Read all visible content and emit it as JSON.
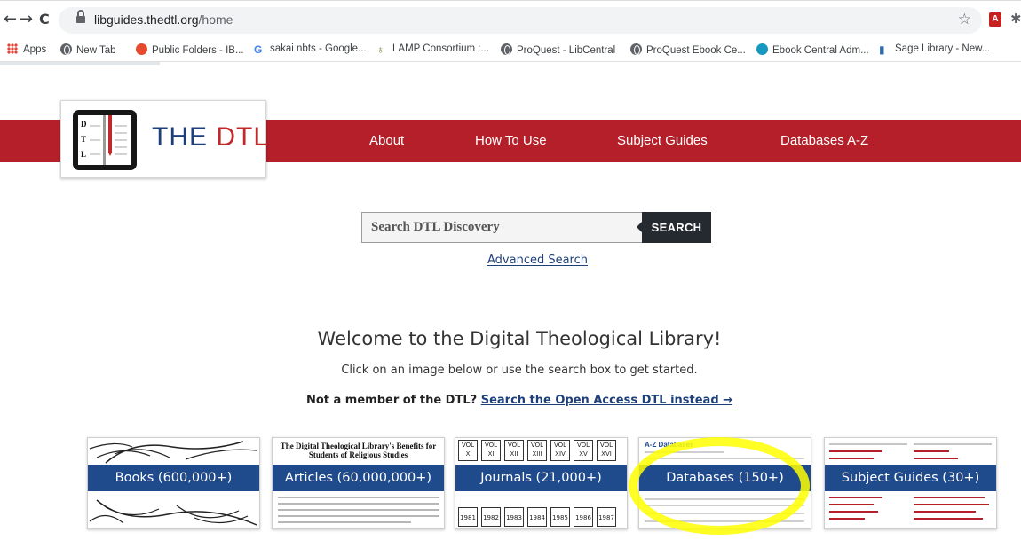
{
  "browser": {
    "url_host": "libguides.thedtl.org",
    "url_path": "/home",
    "back_glyph": "←",
    "forward_glyph": "→",
    "reload_glyph": "C",
    "star_glyph": "☆",
    "pdf_glyph": "A",
    "pin_glyph": "✱",
    "bookmarks": [
      {
        "label": "Apps",
        "icon": "apps-grid-icon"
      },
      {
        "label": "New Tab",
        "icon": "globe-icon"
      },
      {
        "label": "Public Folders - IB...",
        "icon": "public-folders-icon"
      },
      {
        "label": "sakai nbts - Google...",
        "icon": "google-icon"
      },
      {
        "label": "LAMP Consortium :...",
        "icon": "lamp-icon"
      },
      {
        "label": "ProQuest - LibCentral",
        "icon": "globe-icon"
      },
      {
        "label": "ProQuest Ebook Ce...",
        "icon": "globe-icon"
      },
      {
        "label": "Ebook Central Adm...",
        "icon": "cloud-icon"
      },
      {
        "label": "Sage Library - New...",
        "icon": "sage-icon"
      }
    ],
    "icon_glyphs": {
      "google": "G",
      "lamp": "♁",
      "sage": "▮"
    }
  },
  "site": {
    "logo_text_main": "THE ",
    "logo_text_accent": "DTL",
    "logo_book_letters": [
      "D",
      "T",
      "L"
    ],
    "nav": [
      "About",
      "How To Use",
      "Subject Guides",
      "Databases A-Z"
    ],
    "search": {
      "placeholder": "Search DTL Discovery",
      "button": "SEARCH"
    },
    "advanced_search": "Advanced Search",
    "welcome": "Welcome to the Digital Theological Library!",
    "subtitle": "Click on an image below or use the search box to get started.",
    "member_prefix": "Not a member of the DTL? ",
    "member_link": "Search the Open Access DTL instead →",
    "cards": [
      {
        "label": "Books (600,000+)"
      },
      {
        "label": "Articles (60,000,000+)",
        "doc_title": "The Digital Theological Library's Benefits for Students of Religious Studies"
      },
      {
        "label": "Journals (21,000+)",
        "vols": [
          "VOL X",
          "VOL XI",
          "VOL XII",
          "VOL XIII",
          "VOL XIV",
          "VOL XV",
          "VOL XVI"
        ],
        "years": [
          "1981",
          "1982",
          "1983",
          "1984",
          "1985",
          "1986",
          "1987"
        ]
      },
      {
        "label": "Databases (150+)",
        "header": "A-Z Databases"
      },
      {
        "label": "Subject Guides (30+)"
      }
    ],
    "colors": {
      "brand_red": "#b41f2a",
      "brand_blue": "#1f4a8c",
      "logo_blue": "#1e3f7a",
      "highlight": "#ffff00"
    }
  }
}
